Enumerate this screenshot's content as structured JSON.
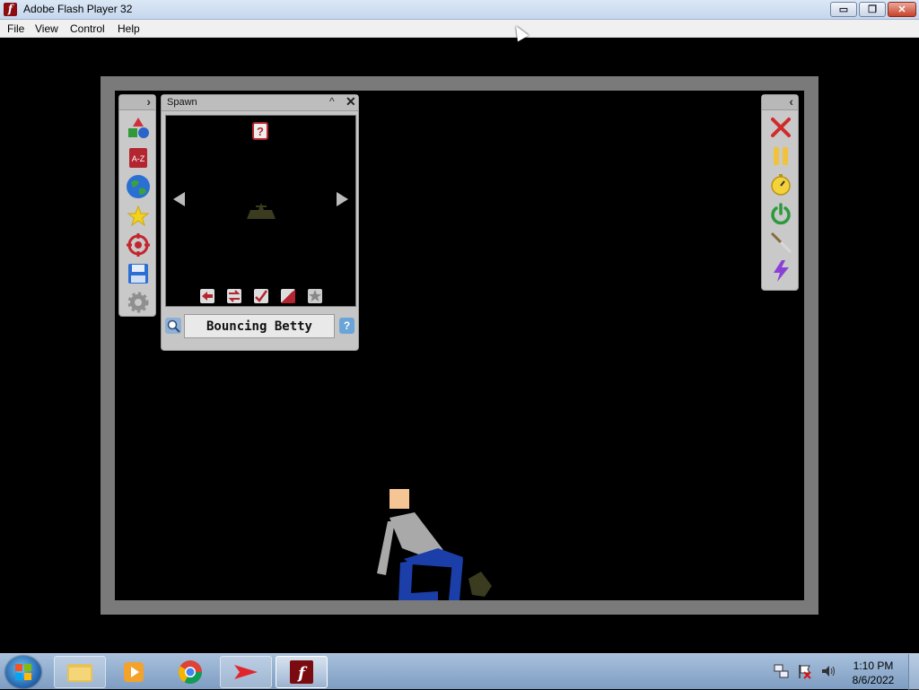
{
  "window": {
    "title": "Adobe Flash Player 32",
    "app_icon_letter": "f",
    "controls": {
      "minimize": "▭",
      "maximize": "❐",
      "close": "✕"
    }
  },
  "menu": [
    "File",
    "View",
    "Control",
    "Help"
  ],
  "left_toolbar": {
    "collapse_glyph": "›",
    "tools": [
      "shapes-icon",
      "a-z-icon",
      "globe-icon",
      "star-icon",
      "target-icon",
      "save-icon",
      "gear-icon"
    ],
    "az_label": "A-Z"
  },
  "spawn_panel": {
    "title": "Spawn",
    "minimize_glyph": "^",
    "close_glyph": "✕",
    "selected_item": "Bouncing Betty",
    "help_glyph": "?",
    "top_icon": "?"
  },
  "right_toolbar": {
    "collapse_glyph": "‹",
    "tools": [
      "close-icon",
      "pause-icon",
      "stopwatch-icon",
      "power-icon",
      "knife-icon",
      "lightning-icon"
    ]
  },
  "taskbar": {
    "apps": [
      "file-explorer-icon",
      "media-player-icon",
      "chrome-icon",
      "arrow-app-icon",
      "flash-player-icon"
    ],
    "time": "1:10 PM",
    "date": "8/6/2022"
  },
  "colors": {
    "stage_frame": "#7a7a7a",
    "panel_bg": "#c6c6c6",
    "ragdoll_head": "#f6c596",
    "ragdoll_body": "#a9a9a9",
    "ragdoll_legs": "#1b3ea8",
    "mine": "#3b3b1f"
  }
}
